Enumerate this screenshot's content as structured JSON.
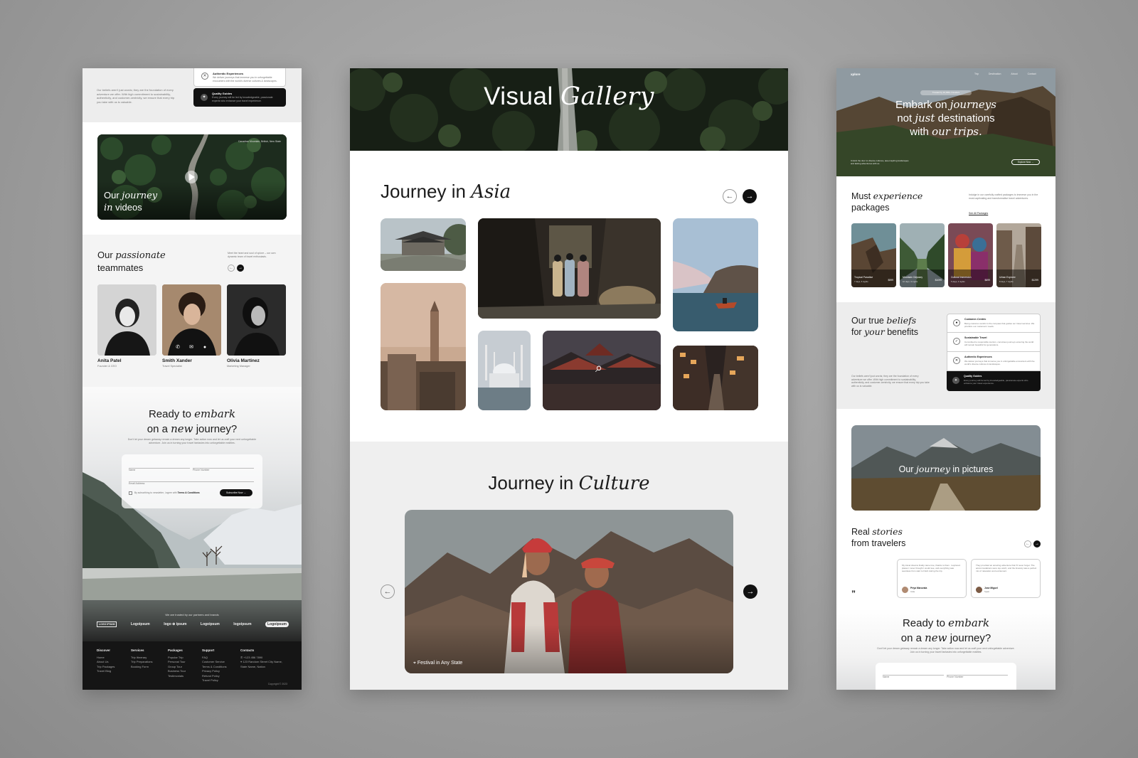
{
  "left": {
    "beliefs_intro": "Our beliefs aren't just words; they are the foundation of every adventure we offer. With high commitment to sustainability, authenticity, and customer-centricity, we ensure that every trip you take with us is valuable.",
    "benefit_authentic_title": "Authentic Experiences",
    "benefit_authentic_desc": "We deliver journeys that immerse you in unforgettable encounters with the world's diverse cultures & landscapes.",
    "benefit_guides_title": "Quality Guides",
    "benefit_guides_desc": "Every journey will be led by knowledgeable, passionate experts who enhance your travel experience.",
    "video_location": "Canadian Mountain, British, New State",
    "video_title_1": "Our",
    "video_title_em": "journey",
    "video_title_2": "in",
    "video_title_3": "videos",
    "team_title_1": "Our",
    "team_title_em": "passionate",
    "team_title_2": "teammates",
    "team_desc": "Meet the heart and soul of xplore – our own dynamic team of travel enthusiasts.",
    "team": [
      {
        "name": "Anita Patel",
        "role": "Founder & CEO"
      },
      {
        "name": "Smith Xander",
        "role": "Travel Specialist"
      },
      {
        "name": "Olivia Martinez",
        "role": "Marketing Manager"
      }
    ],
    "cta_1": "Ready to",
    "cta_em1": "embark",
    "cta_2": "on a",
    "cta_em2": "new",
    "cta_3": "journey?",
    "cta_desc": "Don't let your dream getaway remain a dream any longer. Take action now and let us craft your next unforgettable adventure. Join us in turning your travel fantasies into unforgettable realities.",
    "form_name": "Name",
    "form_phone": "Phone Number",
    "form_email": "Email Address",
    "form_consent_1": "By subscribing to newsletter, I agree with",
    "form_consent_link": "Terms & Conditions",
    "form_button": "Subscribe Now",
    "partners_label": "We are trusted by our partners and brands",
    "partners": [
      "LOGO IPSUM",
      "Logoipsum",
      "logo ⊕ ipsum",
      "Logoipsum",
      "logoipsum",
      "Logoipsum"
    ],
    "footer": [
      {
        "title": "Discover",
        "links": [
          "Home",
          "About Us",
          "Trip Packages",
          "Travel Blog"
        ]
      },
      {
        "title": "Services",
        "links": [
          "Trip Itinerary",
          "Trip Preparations",
          "Booking Form"
        ]
      },
      {
        "title": "Packages",
        "links": [
          "Popular Trip",
          "Personal Tour",
          "Group Tour",
          "Business Tour",
          "Testimonials"
        ]
      },
      {
        "title": "Support",
        "links": [
          "FAQ",
          "Customer Service",
          "Terms & Conditions",
          "Privacy Policy",
          "Refund Policy",
          "Travel Policy"
        ]
      }
    ],
    "contacts_title": "Contacts",
    "contact_phone": "+123 456 7890",
    "contact_address": "123 Random Street City Name, State Name, Nation",
    "copyright": "Copyright © 2023"
  },
  "middle": {
    "hero_title": "Visual",
    "hero_em": "Gallery",
    "asia_title": "Journey in",
    "asia_em": "Asia",
    "culture_title": "Journey in",
    "culture_em": "Culture",
    "culture_caption": "Festival in Any State"
  },
  "right": {
    "logo": "xplore",
    "nav": [
      "Trip",
      "Destination",
      "About",
      "Contact"
    ],
    "hero_badge": "Trusted by 10,000+ travelers",
    "hero_1": "Embark on",
    "hero_em1": "journeys",
    "hero_2": "not",
    "hero_em2": "just",
    "hero_3": "destinations",
    "hero_4": "with",
    "hero_em3": "our trips.",
    "hero_desc": "Unlock the door to diverse cultures, awe-inspiring landscapes and lasting adventures with us",
    "hero_button": "Explore Now",
    "packages_1": "Must",
    "packages_em": "experience",
    "packages_2": "packages",
    "packages_desc": "Indulge in our carefully crafted packages to immerse you in the most captivating and transformative travel adventures.",
    "packages_link": "See All Packages",
    "packages": [
      {
        "name": "Tropical Paradise",
        "days": "7 days, 6 nights",
        "price": "$599"
      },
      {
        "name": "Mountain Odyssey",
        "days": "10 days, 9 nights",
        "price": "$1099"
      },
      {
        "name": "Cultural Immersion",
        "days": "5 days, 4 nights",
        "price": "$699"
      },
      {
        "name": "Urban Explorer",
        "days": "8 days, 7 nights",
        "price": "$1299"
      }
    ],
    "beliefs_1": "Our true",
    "beliefs_em": "beliefs",
    "beliefs_2": "for",
    "beliefs_em2": "your",
    "beliefs_3": "benefits",
    "beliefs_desc": "Our beliefs aren't just words; they are the foundation of every adventure we offer. With high commitment to sustainability, authenticity, and customer-centricity, we ensure that every trip you take with us is valuable.",
    "benefits": [
      {
        "title": "Customer-Centric",
        "desc": "Being customer-centric is the compass that guides our travel services. We prioritize our customers' needs."
      },
      {
        "title": "Sustainable Travel",
        "desc": "Committed to responsible tourism, conscious journeys ensuring the world will remain beautiful for generations."
      },
      {
        "title": "Authentic Experiences",
        "desc": "We deliver journeys that immerse you in unforgettable encounters with the world's diverse cultures & landscapes."
      },
      {
        "title": "Quality Guides",
        "desc": "Every journey will be led by knowledgeable, passionate experts who enhance your travel experience."
      }
    ],
    "pictures_1": "Our",
    "pictures_em": "journey",
    "pictures_2": "in pictures",
    "stories_1": "Real",
    "stories_em": "stories",
    "stories_2": "from travelers",
    "reviews": [
      {
        "text": "My travel dreams finally came true, thanks to them. I explored places I never thought I would see, and everything was seamless from start to finish during the trip.",
        "name": "Priya Maruvala",
        "place": "India"
      },
      {
        "text": "They provided an amazing adventure that I'll never forget. The accommodations were top-notch, and the itinerary was a perfect mix of relaxation and excitement.",
        "name": "Jose Miguel",
        "place": "Spain"
      }
    ],
    "cta_1": "Ready to",
    "cta_em1": "embark",
    "cta_2": "on a",
    "cta_em2": "new",
    "cta_3": "journey?",
    "cta_desc": "Don't let your dream getaway remain a dream any longer. Take action now and let us craft your next unforgettable adventure. Join us in turning your travel fantasies into unforgettable realities.",
    "form_name": "Name",
    "form_phone": "Phone Number"
  }
}
